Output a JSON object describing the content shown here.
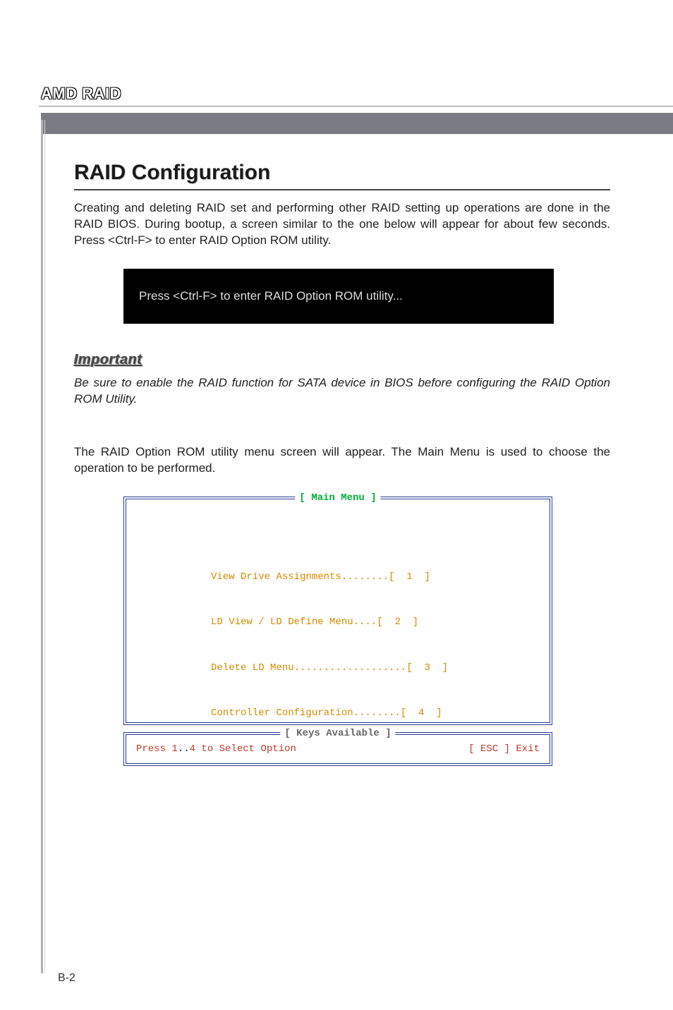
{
  "header": {
    "appendix_label": "AMD RAID"
  },
  "section": {
    "title": "RAID Configuration",
    "intro": "Creating and deleting RAID set and performing other RAID setting up operations are done in the RAID BIOS. During bootup, a screen similar to the one below will appear for about few seconds. Press <Ctrl-F> to enter RAID Option ROM utility.",
    "prompt_box": "Press <Ctrl-F> to enter RAID Option ROM utility...",
    "important_label": "Important",
    "important_text": "Be sure to enable the RAID function for SATA device in BIOS before configuring the RAID Option ROM Utility.",
    "post_text": "The RAID Option ROM utility menu screen will appear. The Main Menu is used to choose the operation to be performed."
  },
  "bios": {
    "main_menu_title": "[ Main Menu ]",
    "items": [
      "View Drive Assignments........[  1  ]",
      "LD View / LD Define Menu....[  2  ]",
      "Delete LD Menu...................[  3  ]",
      "Controller Configuration........[  4  ]"
    ],
    "keys_title": "[ Keys Available ]",
    "keys_left_prefix": "Press 1",
    "keys_left_dots": "..",
    "keys_left_suffix": "4 to Select Option",
    "keys_right": "[ ESC ]   Exit"
  },
  "footer": {
    "page_num": "B-2"
  }
}
